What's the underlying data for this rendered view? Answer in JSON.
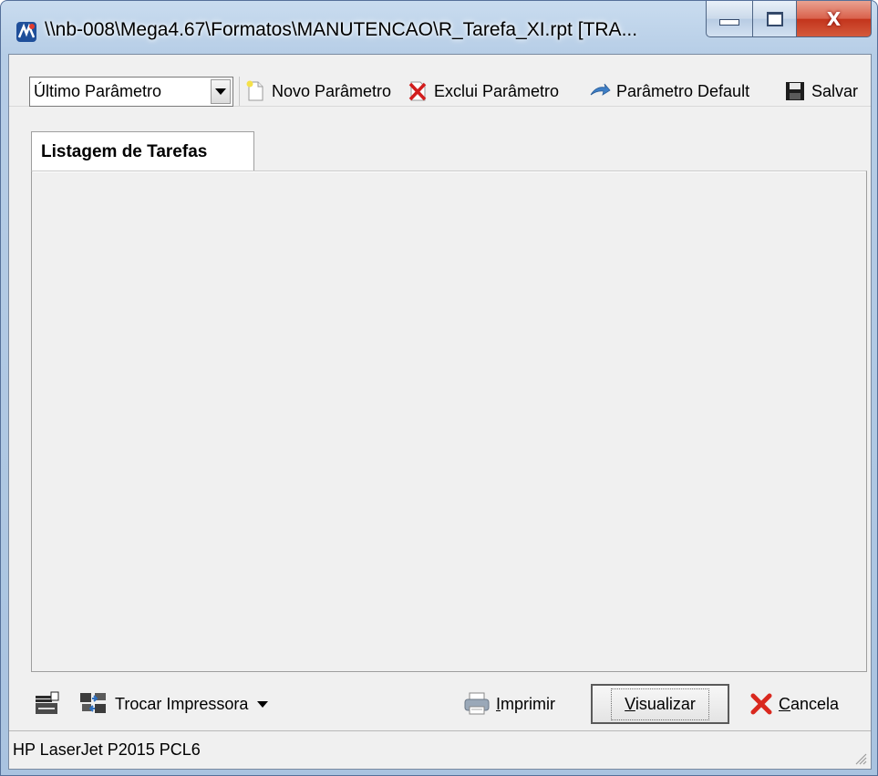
{
  "window": {
    "title": "\\\\nb-008\\Mega4.67\\Formatos\\MANUTENCAO\\R_Tarefa_XI.rpt [TRA...",
    "close_label": "X"
  },
  "toolbar": {
    "parameter_select": {
      "value": "Último Parâmetro"
    },
    "new_label": "Novo Parâmetro",
    "delete_label": "Exclui Parâmetro",
    "default_label": "Parâmetro Default",
    "save_label": "Salvar"
  },
  "tabs": [
    {
      "label": "Listagem de Tarefas",
      "active": true
    }
  ],
  "bottom": {
    "change_printer_label": "Trocar Impressora",
    "print_label_underlined": "I",
    "print_label_rest": "mprimir",
    "preview_label_underlined": "V",
    "preview_label_rest": "isualizar",
    "cancel_label_underlined": "C",
    "cancel_label_rest": "ancela"
  },
  "status": {
    "printer_name": "HP LaserJet P2015 PCL6"
  },
  "colors": {
    "close_red": "#c3341c",
    "title_frame": "#b6cde6",
    "client_bg": "#f0f0f0"
  },
  "icons": [
    "app-logo-icon",
    "minimize-icon",
    "maximize-icon",
    "close-icon",
    "new-document-icon",
    "delete-icon",
    "default-arrow-icon",
    "floppy-save-icon",
    "printer-setup-icon",
    "swap-printer-icon",
    "chevron-down-icon",
    "printer-icon",
    "cancel-x-icon",
    "resize-grip-icon"
  ]
}
